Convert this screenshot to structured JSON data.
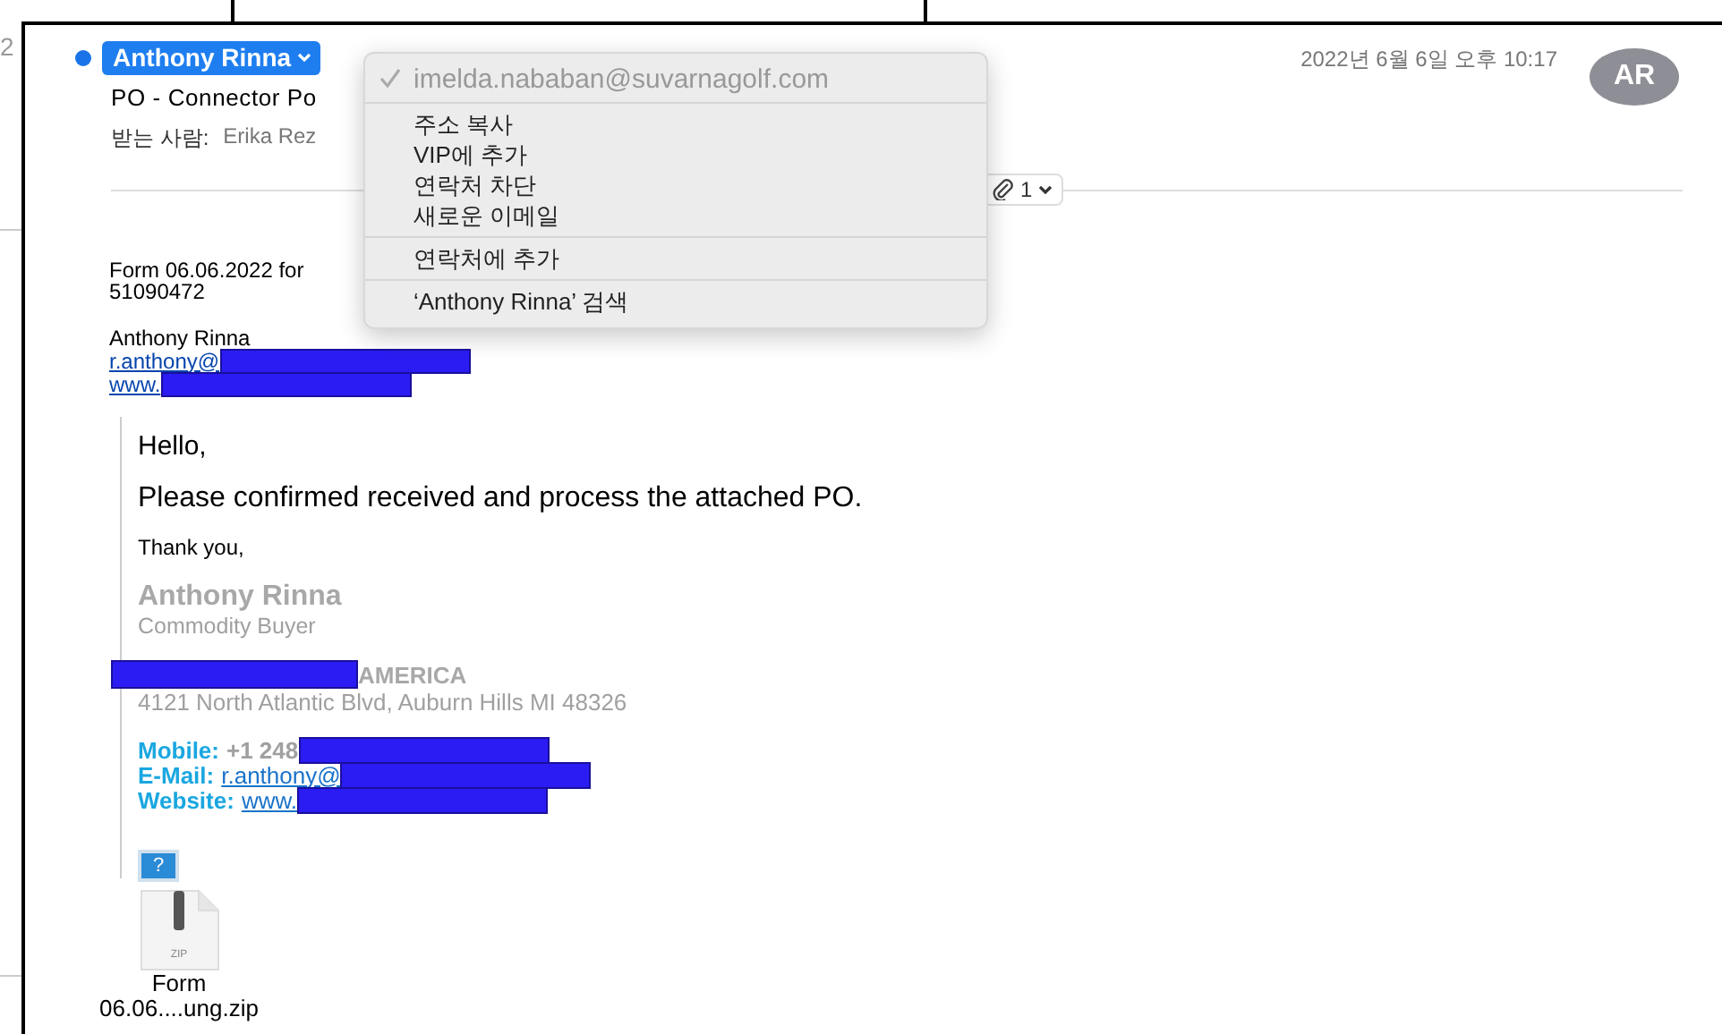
{
  "page_number": "2",
  "header": {
    "sender": "Anthony Rinna",
    "unread": true,
    "subject": "PO - Connector Po",
    "to_label": "받는 사람:",
    "to_value": "Erika Rez",
    "date": "2022년 6월 6일 오후 10:17",
    "avatar": "AR",
    "attachment_count": "1"
  },
  "sender_menu": {
    "sections": [
      {
        "items": [
          {
            "label": "imelda.nababan@suvarnagolf.com",
            "checked": true,
            "disabled": true
          }
        ]
      },
      {
        "items": [
          {
            "label": "주소 복사",
            "checked": false,
            "disabled": false
          },
          {
            "label": "VIP에 추가",
            "checked": false,
            "disabled": false
          },
          {
            "label": "연락처 차단",
            "checked": false,
            "disabled": false
          },
          {
            "label": "새로운 이메일",
            "checked": false,
            "disabled": false
          }
        ]
      },
      {
        "items": [
          {
            "label": "연락처에 추가",
            "checked": false,
            "disabled": false
          }
        ]
      },
      {
        "items": [
          {
            "label": "‘Anthony Rinna’ 검색",
            "checked": false,
            "disabled": false
          }
        ]
      }
    ]
  },
  "message": {
    "forwarded_lines": [
      "Form 06.06.2022 for",
      "51090472"
    ],
    "sender_name": "Anthony Rinna",
    "email_link": "r.anthony@",
    "web_link": "www."
  },
  "quote": {
    "greeting": "Hello,",
    "body": "Please confirmed received and process the attached PO.",
    "closing": "Thank you,",
    "signature": {
      "name": "Anthony Rinna",
      "title": "Commodity Buyer",
      "company": "AMERICA",
      "address": "4121 North Atlantic Blvd, Auburn Hills MI 48326",
      "contacts": [
        {
          "label": "Mobile:",
          "value": "+1 248",
          "kind": "text"
        },
        {
          "label": "E-Mail:",
          "value": "r.anthony@",
          "kind": "link"
        },
        {
          "label": "Website:",
          "value": "www.",
          "kind": "link"
        }
      ]
    },
    "image_placeholder": "?"
  },
  "attachment": {
    "file_type": "ZIP",
    "name_lines": [
      "Form",
      "06.06....ung.zip"
    ]
  }
}
